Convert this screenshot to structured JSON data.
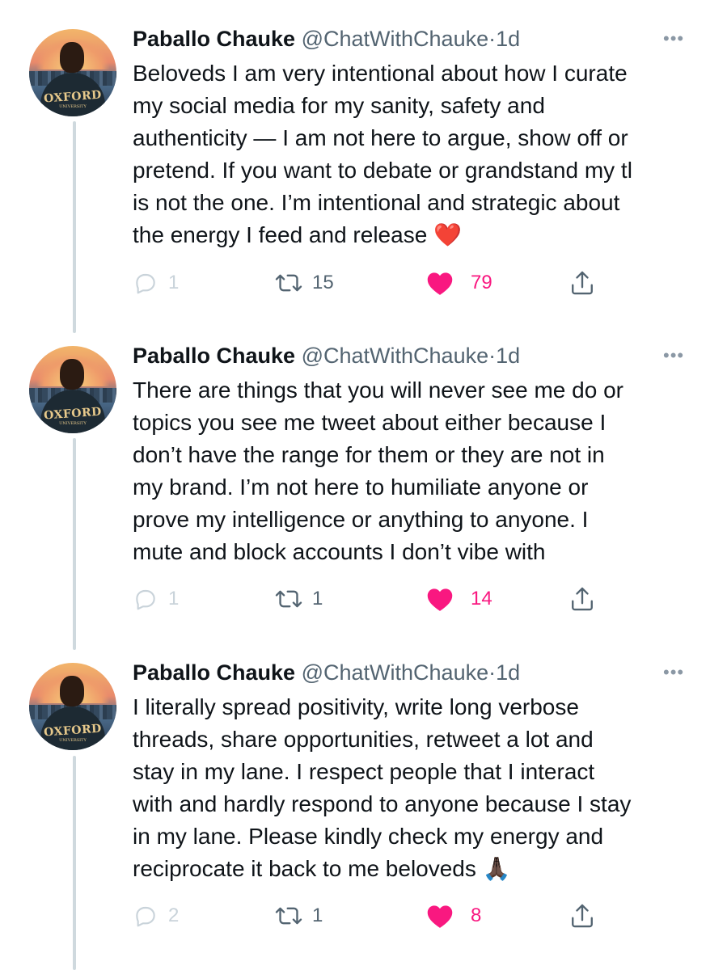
{
  "tweets": [
    {
      "author": "Paballo Chauke",
      "handle": "@ChatWithChauke",
      "separator": "·",
      "time": "1d",
      "text": "Beloveds I am very intentional about how I curate\nmy social media for my sanity, safety and\nauthenticity — I am not here to argue, show off or\npretend. If you want to debate or grandstand my tl\nis not the one. I’m intentional and strategic about\nthe energy I feed and release",
      "emoji": "❤️",
      "replies": "1",
      "retweets": "15",
      "likes": "79"
    },
    {
      "author": "Paballo Chauke",
      "handle": "@ChatWithChauke",
      "separator": "·",
      "time": "1d",
      "text": "There are things that you will never see me do or\ntopics you see me tweet about either because I\ndon’t have the range for them or they are not in\nmy brand. I’m not here to humiliate anyone or\nprove my intelligence or anything to anyone. I\nmute and block accounts I don’t vibe with",
      "emoji": "",
      "replies": "1",
      "retweets": "1",
      "likes": "14"
    },
    {
      "author": "Paballo Chauke",
      "handle": "@ChatWithChauke",
      "separator": "·",
      "time": "1d",
      "text": "I literally spread positivity, write long verbose\nthreads, share opportunities, retweet a lot and\nstay in my lane. I respect people that I interact\nwith and hardly respond to anyone because I stay\nin my lane. Please kindly check my energy and\nreciprocate it back to me beloveds",
      "emoji": "🙏🏿",
      "replies": "2",
      "retweets": "1",
      "likes": "8"
    }
  ],
  "avatar": {
    "logo_text": "OXFORD",
    "sub_text": "UNIVERSITY"
  },
  "colors": {
    "like": "#f91880",
    "muted": "#536471",
    "thread_line": "#cfd9de",
    "reply_faded": "#c9d3da"
  },
  "icons": [
    "reply-icon",
    "retweet-icon",
    "like-icon",
    "share-icon",
    "more-icon"
  ]
}
